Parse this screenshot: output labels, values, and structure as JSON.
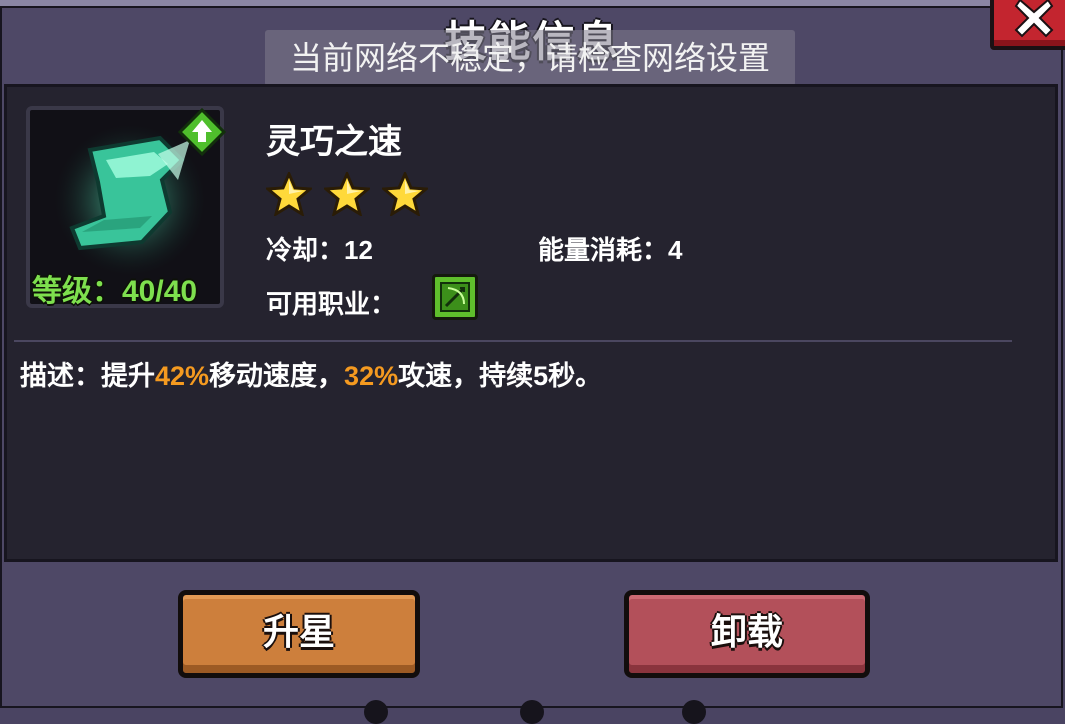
{
  "dialog": {
    "title": "技能信息"
  },
  "toast": {
    "message": "当前网络不稳定，请检查网络设置"
  },
  "close_button": {
    "icon": "close-icon",
    "color": "#c3252f"
  },
  "skill": {
    "icon": "boot-skill-icon",
    "badge_icon": "upgrade-badge-icon",
    "level_label": "等级：40/40",
    "name": "灵巧之速",
    "stars": 3,
    "cooldown_label": "冷却：12",
    "energy_label": "能量消耗：4",
    "class_label": "可用职业：",
    "class_icon": "archer-class-icon",
    "description": {
      "prefix": "描述：提升",
      "value1": "42%",
      "mid": "移动速度，",
      "value2": "32%",
      "suffix": "攻速，持续5秒。"
    }
  },
  "buttons": {
    "upgrade_label": "升星",
    "unequip_label": "卸载"
  },
  "colors": {
    "highlight": "#f59a20",
    "level": "#7ee04e",
    "upgrade_button": "#cd7f3c",
    "unequip_button": "#b3505a"
  }
}
